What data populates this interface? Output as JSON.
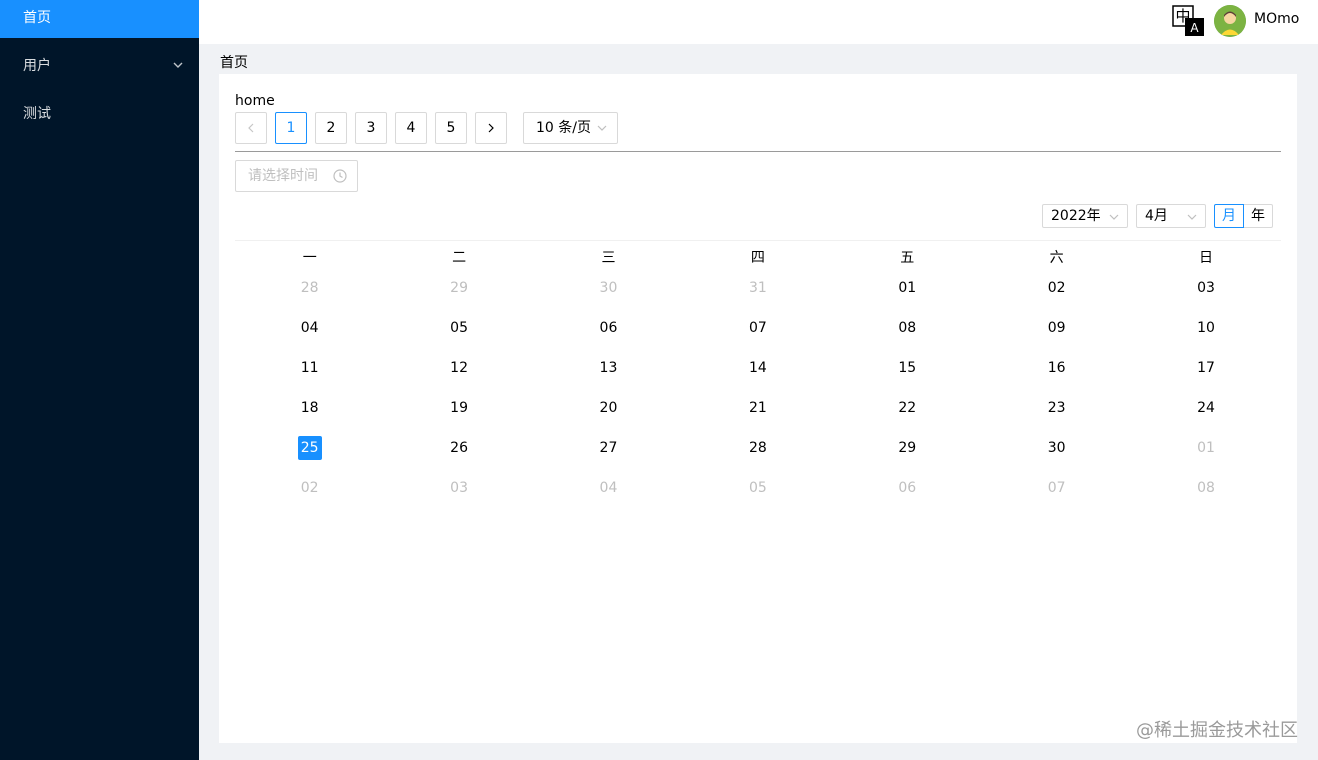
{
  "sidebar": {
    "items": [
      {
        "label": "首页"
      },
      {
        "label": "用户"
      },
      {
        "label": "测试"
      }
    ]
  },
  "header": {
    "lang_icon": "translate-icon",
    "username": "MOmo"
  },
  "breadcrumb": "首页",
  "main": {
    "title": "home",
    "pagination": {
      "prev": "<",
      "next": ">",
      "pages": [
        "1",
        "2",
        "3",
        "4",
        "5"
      ],
      "current": "1",
      "page_size": "10 条/页"
    },
    "time_picker": {
      "placeholder": "请选择时间",
      "icon": "clock-icon"
    },
    "calendar": {
      "year": "2022年",
      "month": "4月",
      "mode_month": "月",
      "mode_year": "年",
      "weekdays": [
        "一",
        "二",
        "三",
        "四",
        "五",
        "六",
        "日"
      ],
      "weeks": [
        [
          "28",
          "29",
          "30",
          "31",
          "01",
          "02",
          "03"
        ],
        [
          "04",
          "05",
          "06",
          "07",
          "08",
          "09",
          "10"
        ],
        [
          "11",
          "12",
          "13",
          "14",
          "15",
          "16",
          "17"
        ],
        [
          "18",
          "19",
          "20",
          "21",
          "22",
          "23",
          "24"
        ],
        [
          "25",
          "26",
          "27",
          "28",
          "29",
          "30",
          "01"
        ],
        [
          "02",
          "03",
          "04",
          "05",
          "06",
          "07",
          "08"
        ]
      ],
      "today": "25",
      "accent": "#1890ff"
    }
  },
  "watermark": "@稀土掘金技术社区"
}
